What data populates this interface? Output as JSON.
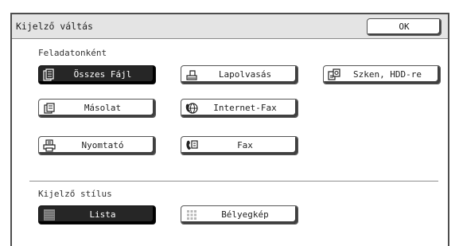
{
  "dialog": {
    "title": "Kijelző váltás",
    "ok_label": "OK"
  },
  "feladatonkent": {
    "label": "Feladatonként",
    "buttons": [
      {
        "label": "Összes Fájl",
        "icon": "all-files-icon",
        "selected": true
      },
      {
        "label": "Lapolvasás",
        "icon": "scan-icon",
        "selected": false
      },
      {
        "label": "Szken, HDD-re",
        "icon": "scan-to-hdd-icon",
        "selected": false
      },
      {
        "label": "Másolat",
        "icon": "copy-icon",
        "selected": false
      },
      {
        "label": "Internet-Fax",
        "icon": "internet-fax-icon",
        "selected": false
      },
      {
        "label": "Nyomtató",
        "icon": "printer-icon",
        "selected": false
      },
      {
        "label": "Fax",
        "icon": "fax-icon",
        "selected": false
      }
    ]
  },
  "kijelzo_stilus": {
    "label": "Kijelző stílus",
    "buttons": [
      {
        "label": "Lista",
        "icon": "list-icon",
        "selected": true
      },
      {
        "label": "Bélyegkép",
        "icon": "thumbnail-icon",
        "selected": false
      }
    ]
  }
}
